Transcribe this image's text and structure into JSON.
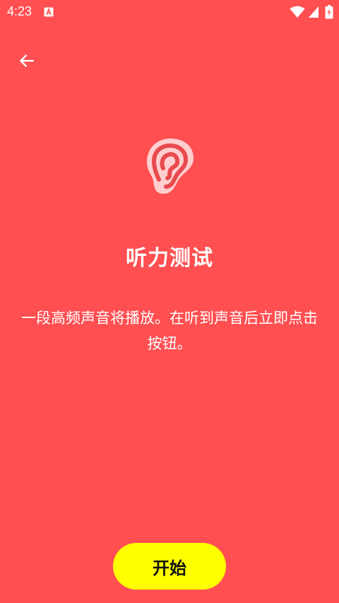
{
  "status_bar": {
    "time": "4:23",
    "app_icon": "app-notification-icon",
    "wifi_icon": "wifi-icon",
    "signal_icon": "signal-icon",
    "battery_icon": "battery-charging-icon"
  },
  "toolbar": {
    "back_icon": "arrow-left-icon"
  },
  "main": {
    "icon": "ear-icon",
    "title": "听力测试",
    "description": "一段高频声音将播放。在听到声音后立即点击按钮。"
  },
  "footer": {
    "start_label": "开始"
  },
  "colors": {
    "background": "#FF4F51",
    "button": "#FFFF00",
    "text": "#FFFFFF",
    "button_text": "#111111"
  }
}
